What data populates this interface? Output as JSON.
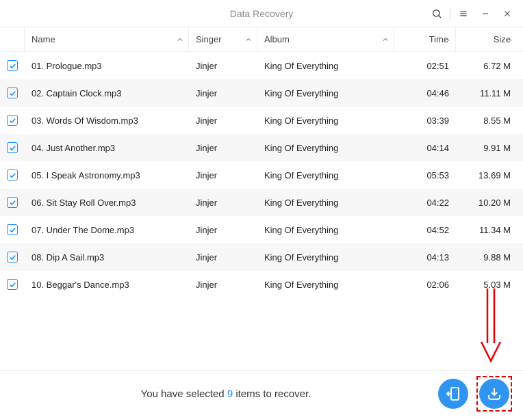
{
  "window_title": "Data Recovery",
  "columns": {
    "name": "Name",
    "singer": "Singer",
    "album": "Album",
    "time": "Time",
    "size": "Size"
  },
  "files": [
    {
      "name": "01. Prologue.mp3",
      "singer": "Jinjer",
      "album": "King Of Everything",
      "time": "02:51",
      "size": "6.72 M"
    },
    {
      "name": "02. Captain Clock.mp3",
      "singer": "Jinjer",
      "album": "King Of Everything",
      "time": "04:46",
      "size": "11.11 M"
    },
    {
      "name": "03. Words Of Wisdom.mp3",
      "singer": "Jinjer",
      "album": "King Of Everything",
      "time": "03:39",
      "size": "8.55 M"
    },
    {
      "name": "04. Just Another.mp3",
      "singer": "Jinjer",
      "album": "King Of Everything",
      "time": "04:14",
      "size": "9.91 M"
    },
    {
      "name": "05. I Speak Astronomy.mp3",
      "singer": "Jinjer",
      "album": "King Of Everything",
      "time": "05:53",
      "size": "13.69 M"
    },
    {
      "name": "06. Sit Stay Roll Over.mp3",
      "singer": "Jinjer",
      "album": "King Of Everything",
      "time": "04:22",
      "size": "10.20 M"
    },
    {
      "name": "07. Under The Dome.mp3",
      "singer": "Jinjer",
      "album": "King Of Everything",
      "time": "04:52",
      "size": "11.34 M"
    },
    {
      "name": "08. Dip A Sail.mp3",
      "singer": "Jinjer",
      "album": "King Of Everything",
      "time": "04:13",
      "size": "9.88 M"
    },
    {
      "name": "10. Beggar's Dance.mp3",
      "singer": "Jinjer",
      "album": "King Of Everything",
      "time": "02:06",
      "size": "5.03 M"
    }
  ],
  "footer": {
    "prefix": "You have selected ",
    "count": "9",
    "suffix": " items to recover."
  },
  "colors": {
    "accent": "#1a8cff",
    "button": "#2f95f0",
    "annotation": "#e40000"
  }
}
